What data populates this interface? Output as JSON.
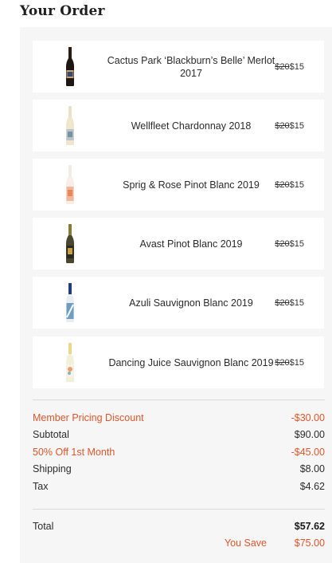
{
  "header": {
    "title": "Your Order"
  },
  "items": [
    {
      "name": "Cactus Park ‘Blackburn’s Belle’ Merlot 2017",
      "old_price": "$20",
      "price": "$15",
      "bottle_icon": "red-wine-bottle"
    },
    {
      "name": "Wellfleet Chardonnay 2018",
      "old_price": "$20",
      "price": "$15",
      "bottle_icon": "white-wine-bottle"
    },
    {
      "name": "Sprig & Rose Pinot Blanc 2019",
      "old_price": "$20",
      "price": "$15",
      "bottle_icon": "rose-wine-bottle"
    },
    {
      "name": "Avast Pinot Blanc 2019",
      "old_price": "$20",
      "price": "$15",
      "bottle_icon": "dark-wine-bottle"
    },
    {
      "name": "Azuli Sauvignon Blanc 2019",
      "old_price": "$20",
      "price": "$15",
      "bottle_icon": "blue-label-wine-bottle"
    },
    {
      "name": "Dancing Juice Sauvignon Blanc 2019",
      "old_price": "$20",
      "price": "$15",
      "bottle_icon": "white-wine-bottle"
    }
  ],
  "summary": {
    "member_discount": {
      "label": "Member Pricing Discount",
      "value": "-$30.00"
    },
    "subtotal": {
      "label": "Subtotal",
      "value": "$90.00"
    },
    "first_month": {
      "label": "50% Off 1st Month",
      "value": "-$45.00"
    },
    "shipping": {
      "label": "Shipping",
      "value": "$8.00"
    },
    "tax": {
      "label": "Tax",
      "value": "$4.62"
    },
    "total": {
      "label": "Total",
      "value": "$57.62"
    },
    "you_save": {
      "label": "You Save",
      "value": "$75.00"
    }
  },
  "colors": {
    "accent": "#e0552a",
    "panel_bg": "#f6f6f6"
  }
}
